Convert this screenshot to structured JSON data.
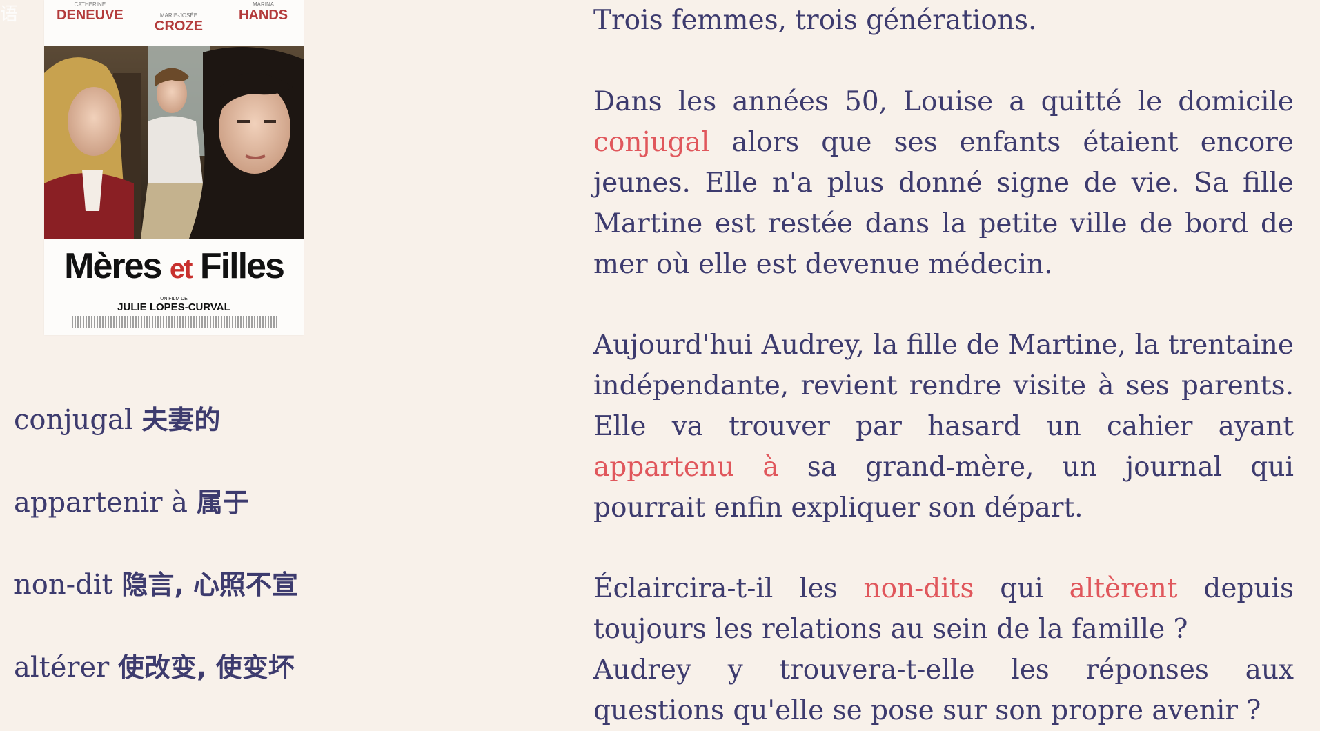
{
  "watermark": "语",
  "poster": {
    "cast": [
      {
        "first": "CATHERINE",
        "last": "DENEUVE"
      },
      {
        "first": "MARIE-JOSÉE",
        "last": "CROZE"
      },
      {
        "first": "MARINA",
        "last": "HANDS"
      }
    ],
    "title_a": "Mères",
    "title_et": "et",
    "title_b": "Filles",
    "director_prefix": "UN FILM DE",
    "director": "JULIE LOPES-CURVAL"
  },
  "vocab": [
    {
      "fr": "conjugal",
      "zh": "夫妻的"
    },
    {
      "fr": "appartenir à",
      "zh": "属于"
    },
    {
      "fr": "non-dit",
      "zh": "隐言, 心照不宣"
    },
    {
      "fr": "altérer",
      "zh": "使改变, 使变坏"
    }
  ],
  "paragraphs": {
    "p1": "Trois femmes, trois générations.",
    "p2": {
      "a": "Dans les années 50, Louise a quitté le domicile ",
      "hl1": "conjugal",
      "b": " alors que ses enfants étaient encore jeunes. Elle n'a plus donné signe de vie. Sa fille Martine est restée dans la petite ville de bord de mer où elle est devenue médecin."
    },
    "p3": {
      "a": "Aujourd'hui Audrey, la fille de Martine, la trentaine indépendante, revient rendre visite à ses parents. Elle va trouver par hasard un cahier ayant ",
      "hl1": "appartenu à",
      "b": " sa grand-mère, un journal qui pourrait enfin expliquer son départ."
    },
    "p4": {
      "a": "Éclaircira-t-il les ",
      "hl1": "non-dits",
      "b": " qui ",
      "hl2": "altèrent",
      "c": " depuis toujours les relations au sein de la famille ?"
    },
    "p5": "Audrey y trouvera-t-elle les réponses aux questions qu'elle se pose sur son propre avenir ?"
  },
  "colors": {
    "text": "#3d3b6e",
    "highlight": "#e0575c",
    "background": "#f8f1ea"
  }
}
